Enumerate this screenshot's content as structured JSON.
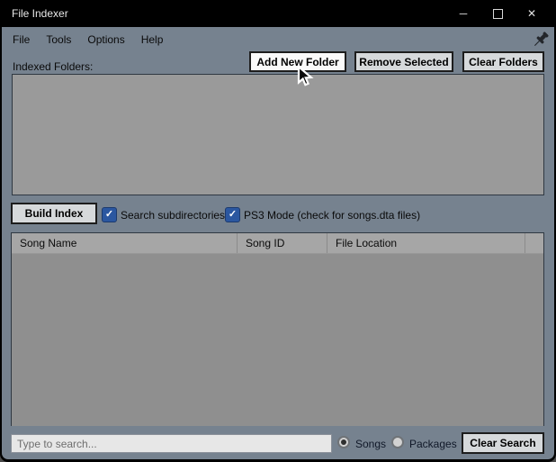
{
  "window": {
    "title": "File Indexer",
    "icons": {
      "minimize": "─",
      "close": "✕"
    }
  },
  "menu": {
    "items": [
      "File",
      "Tools",
      "Options",
      "Help"
    ]
  },
  "toolbar": {
    "add_new_folder": "Add New Folder",
    "remove_selected": "Remove Selected",
    "clear_folders": "Clear Folders"
  },
  "folders_panel": {
    "label": "Indexed Folders:",
    "items": []
  },
  "index_bar": {
    "build_index": "Build Index",
    "checkboxes": [
      {
        "label": "Search subdirectories",
        "checked": true
      },
      {
        "label": "PS3 Mode (check for songs.dta files)",
        "checked": true
      }
    ]
  },
  "song_table": {
    "columns": [
      "Song Name",
      "Song ID",
      "File Location"
    ],
    "rows": []
  },
  "search_bar": {
    "placeholder": "Type to search...",
    "value": "",
    "radios": [
      {
        "label": "Songs",
        "selected": true
      },
      {
        "label": "Packages",
        "selected": false
      }
    ],
    "clear_search": "Clear Search"
  },
  "colors": {
    "titlebar": "#000000",
    "window_background": "#76828F",
    "panel_gray": "#9A9A9A",
    "table_header": "#A6A6A6",
    "table_body": "#8F8F8F",
    "checkbox_accent": "#2B57A0",
    "button_face": "#D6D9DB",
    "button_hover": "#FAFAFA"
  }
}
